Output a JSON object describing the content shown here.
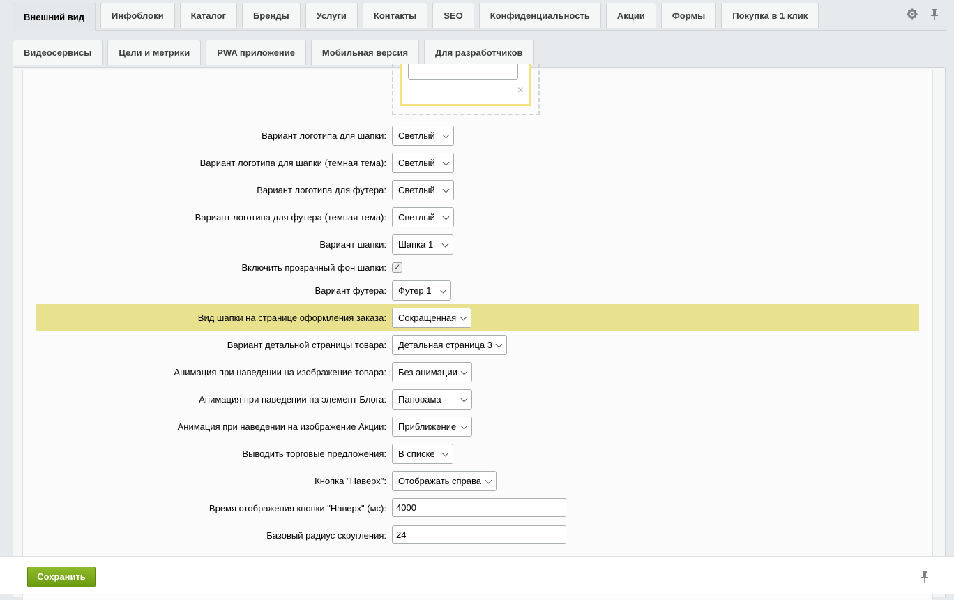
{
  "tabs_row1": [
    {
      "label": "Внешний вид",
      "active": true
    },
    {
      "label": "Инфоблоки"
    },
    {
      "label": "Каталог"
    },
    {
      "label": "Бренды"
    },
    {
      "label": "Услуги"
    },
    {
      "label": "Контакты"
    },
    {
      "label": "SEO"
    },
    {
      "label": "Конфиденциальность"
    },
    {
      "label": "Акции"
    },
    {
      "label": "Формы"
    },
    {
      "label": "Покупка в 1 клик"
    }
  ],
  "tabs_row2": [
    {
      "label": "Видеосервисы"
    },
    {
      "label": "Цели и метрики"
    },
    {
      "label": "PWA приложение"
    },
    {
      "label": "Мобильная версия"
    },
    {
      "label": "Для разработчиков"
    }
  ],
  "toolbar": {
    "settings_icon": "gear-icon",
    "pin_icon": "pin-icon"
  },
  "logo_preview": {
    "remove_icon": "close-icon",
    "remove_glyph": "×"
  },
  "settings": {
    "logo_header": {
      "label": "Вариант логотипа для шапки:",
      "value": "Светлый"
    },
    "logo_header_dark": {
      "label": "Вариант логотипа для шапки (темная тема):",
      "value": "Светлый"
    },
    "logo_footer": {
      "label": "Вариант логотипа для футера:",
      "value": "Светлый"
    },
    "logo_footer_dark": {
      "label": "Вариант логотипа для футера (темная тема):",
      "value": "Светлый"
    },
    "header_variant": {
      "label": "Вариант шапки:",
      "value": "Шапка 1"
    },
    "transparent_header": {
      "label": "Включить прозрачный фон шапки:",
      "checked": true,
      "glyph": "✓"
    },
    "footer_variant": {
      "label": "Вариант футера:",
      "value": "Футер 1"
    },
    "checkout_header": {
      "label": "Вид шапки на странице оформления заказа:",
      "value": "Сокращенная"
    },
    "product_page": {
      "label": "Вариант детальной страницы товара:",
      "value": "Детальная страница 3"
    },
    "product_hover": {
      "label": "Анимация при наведении на изображение товара:",
      "value": "Без анимации"
    },
    "blog_hover": {
      "label": "Анимация при наведении на элемент Блога:",
      "value": "Панорама"
    },
    "sale_hover": {
      "label": "Анимация при наведении на изображение Акции:",
      "value": "Приближение"
    },
    "offers_view": {
      "label": "Выводить торговые предложения:",
      "value": "В списке"
    },
    "scroll_top": {
      "label": "Кнопка \"Наверх\":",
      "value": "Отображать справа"
    },
    "scroll_top_time": {
      "label": "Время отображения кнопки \"Наверх\" (мс):",
      "value": "4000"
    },
    "border_radius": {
      "label": "Базовый радиус скругления:",
      "value": "24"
    }
  },
  "highlight_color": "#e8e28e",
  "footer": {
    "save_label": "Сохранить",
    "pin_icon": "pin-icon"
  }
}
